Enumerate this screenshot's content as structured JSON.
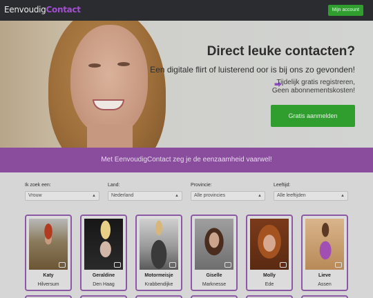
{
  "header": {
    "logo_part1": "Eenvoudig",
    "logo_part2": "Contact",
    "account_label": "Mijn account"
  },
  "hero": {
    "title": "Direct leuke contacten?",
    "subtitle": "Een digitale flirt of luisterend oor is bij ons zo gevonden!",
    "perk_line1": "Tijdelijk gratis registreren,",
    "perk_line2": "Geen abonnementskosten!",
    "perk_icon": "login-icon",
    "cta_label": "Gratis aanmelden"
  },
  "banner": {
    "text": "Met EenvoudigContact zeg je de eenzaamheid vaarwel!"
  },
  "filters": [
    {
      "label": "Ik zoek een:",
      "value": "Vrouw"
    },
    {
      "label": "Land:",
      "value": "Nederland"
    },
    {
      "label": "Provincie:",
      "value": "Alle provincies"
    },
    {
      "label": "Leeftijd:",
      "value": "Alle leeftijden"
    }
  ],
  "profiles": [
    {
      "name": "Katy",
      "city": "Hilversum"
    },
    {
      "name": "Geraldine",
      "city": "Den Haag"
    },
    {
      "name": "Motormeisje",
      "city": "Krabbendijke"
    },
    {
      "name": "Giselle",
      "city": "Marknesse"
    },
    {
      "name": "Molly",
      "city": "Ede"
    },
    {
      "name": "Lieve",
      "city": "Assen"
    }
  ],
  "colors": {
    "brand_purple": "#8a4d9d",
    "button_green": "#2f9e2f",
    "navbar": "#2a2c2f"
  }
}
